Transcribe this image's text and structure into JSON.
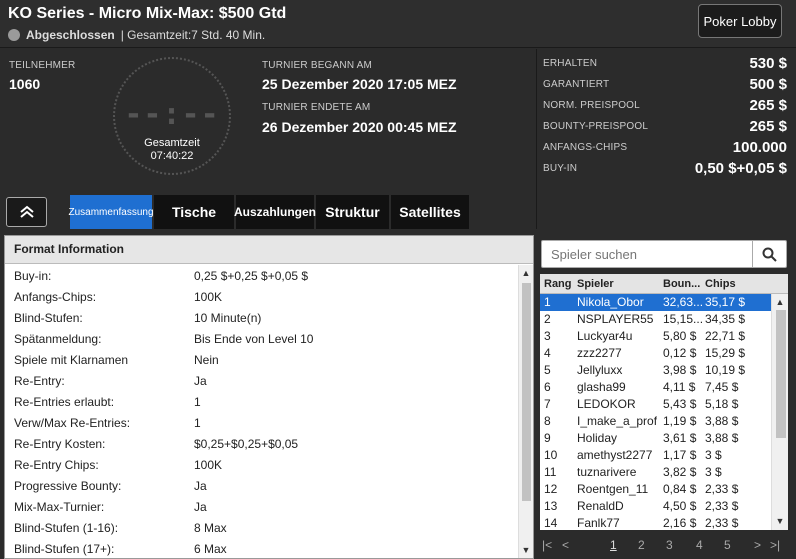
{
  "header": {
    "title": "KO Series - Micro Mix-Max: $500 Gtd",
    "status": "Abgeschlossen",
    "total_time_text": "| Gesamtzeit:7 Std.  40 Min.",
    "lobby_button": "Poker Lobby"
  },
  "info": {
    "participants_label": "TEILNEHMER",
    "participants_value": "1060",
    "clock_digits": "--:--",
    "clock_label": "Gesamtzeit",
    "clock_time": "07:40:22",
    "started_label": "TURNIER BEGANN AM",
    "started_value": "25 Dezember 2020  17:05 MEZ",
    "ended_label": "TURNIER ENDETE AM",
    "ended_value": "26 Dezember 2020  00:45 MEZ"
  },
  "prize": [
    {
      "label": "ERHALTEN",
      "value": "530 $"
    },
    {
      "label": "GARANTIERT",
      "value": "500 $"
    },
    {
      "label": "NORM. PREISPOOL",
      "value": "265 $"
    },
    {
      "label": "BOUNTY-PREISPOOL",
      "value": "265 $"
    },
    {
      "label": "ANFANGS-CHIPS",
      "value": "100.000"
    },
    {
      "label": "BUY-IN",
      "value": "0,50 $+0,05 $"
    }
  ],
  "tabs": [
    {
      "label": "Zusammenfassung",
      "active": true
    },
    {
      "label": "Tische",
      "active": false
    },
    {
      "label": "Auszahlungen",
      "active": false
    },
    {
      "label": "Struktur",
      "active": false
    },
    {
      "label": "Satellites",
      "active": false
    }
  ],
  "format": {
    "title": "Format Information",
    "rows": [
      {
        "k": "Buy-in:",
        "v": "0,25 $+0,25 $+0,05 $"
      },
      {
        "k": "Anfangs-Chips:",
        "v": "100K"
      },
      {
        "k": "Blind-Stufen:",
        "v": "10 Minute(n)"
      },
      {
        "k": "Spätanmeldung:",
        "v": "Bis Ende von Level 10"
      },
      {
        "k": "Spiele mit Klarnamen",
        "v": "Nein"
      },
      {
        "k": "Re-Entry:",
        "v": "Ja"
      },
      {
        "k": "Re-Entries erlaubt:",
        "v": "1"
      },
      {
        "k": "Verw/Max Re-Entries:",
        "v": "1"
      },
      {
        "k": "Re-Entry Kosten:",
        "v": "$0,25+$0,25+$0,05"
      },
      {
        "k": "Re-Entry Chips:",
        "v": "100K"
      },
      {
        "k": "Progressive Bounty:",
        "v": "Ja"
      },
      {
        "k": "Mix-Max-Turnier:",
        "v": "Ja"
      },
      {
        "k": "Blind-Stufen (1-16):",
        "v": "8 Max"
      },
      {
        "k": "Blind-Stufen (17+):",
        "v": "6 Max"
      }
    ]
  },
  "players": {
    "search_placeholder": "Spieler suchen",
    "columns": [
      "Rang",
      "Spieler",
      "Boun...",
      "Chips"
    ],
    "rows": [
      {
        "rank": "1",
        "name": "Nikola_Obor",
        "bounty": "32,63...",
        "chips": "35,17 $",
        "selected": true
      },
      {
        "rank": "2",
        "name": "NSPLAYER55",
        "bounty": "15,15...",
        "chips": "34,35 $"
      },
      {
        "rank": "3",
        "name": "Luckyar4u",
        "bounty": "5,80 $",
        "chips": "22,71 $"
      },
      {
        "rank": "4",
        "name": "zzz2277",
        "bounty": "0,12 $",
        "chips": "15,29 $"
      },
      {
        "rank": "5",
        "name": "Jellyluxx",
        "bounty": "3,98 $",
        "chips": "10,19 $"
      },
      {
        "rank": "6",
        "name": "glasha99",
        "bounty": "4,11 $",
        "chips": "7,45 $"
      },
      {
        "rank": "7",
        "name": "LEDOKOR",
        "bounty": "5,43 $",
        "chips": "5,18 $"
      },
      {
        "rank": "8",
        "name": "I_make_a_profit",
        "bounty": "1,19 $",
        "chips": "3,88 $"
      },
      {
        "rank": "9",
        "name": "Holiday",
        "bounty": "3,61 $",
        "chips": "3,88 $"
      },
      {
        "rank": "10",
        "name": "amethyst2277",
        "bounty": "1,17 $",
        "chips": "3 $"
      },
      {
        "rank": "11",
        "name": "tuznarivere",
        "bounty": "3,82 $",
        "chips": "3 $"
      },
      {
        "rank": "12",
        "name": "Roentgen_11",
        "bounty": "0,84 $",
        "chips": "2,33 $"
      },
      {
        "rank": "13",
        "name": "RenaldD",
        "bounty": "4,50 $",
        "chips": "2,33 $"
      },
      {
        "rank": "14",
        "name": "Fanlk77",
        "bounty": "2,16 $",
        "chips": "2,33 $"
      }
    ],
    "pages": [
      "1",
      "2",
      "3",
      "4",
      "5"
    ],
    "current_page": "1"
  }
}
